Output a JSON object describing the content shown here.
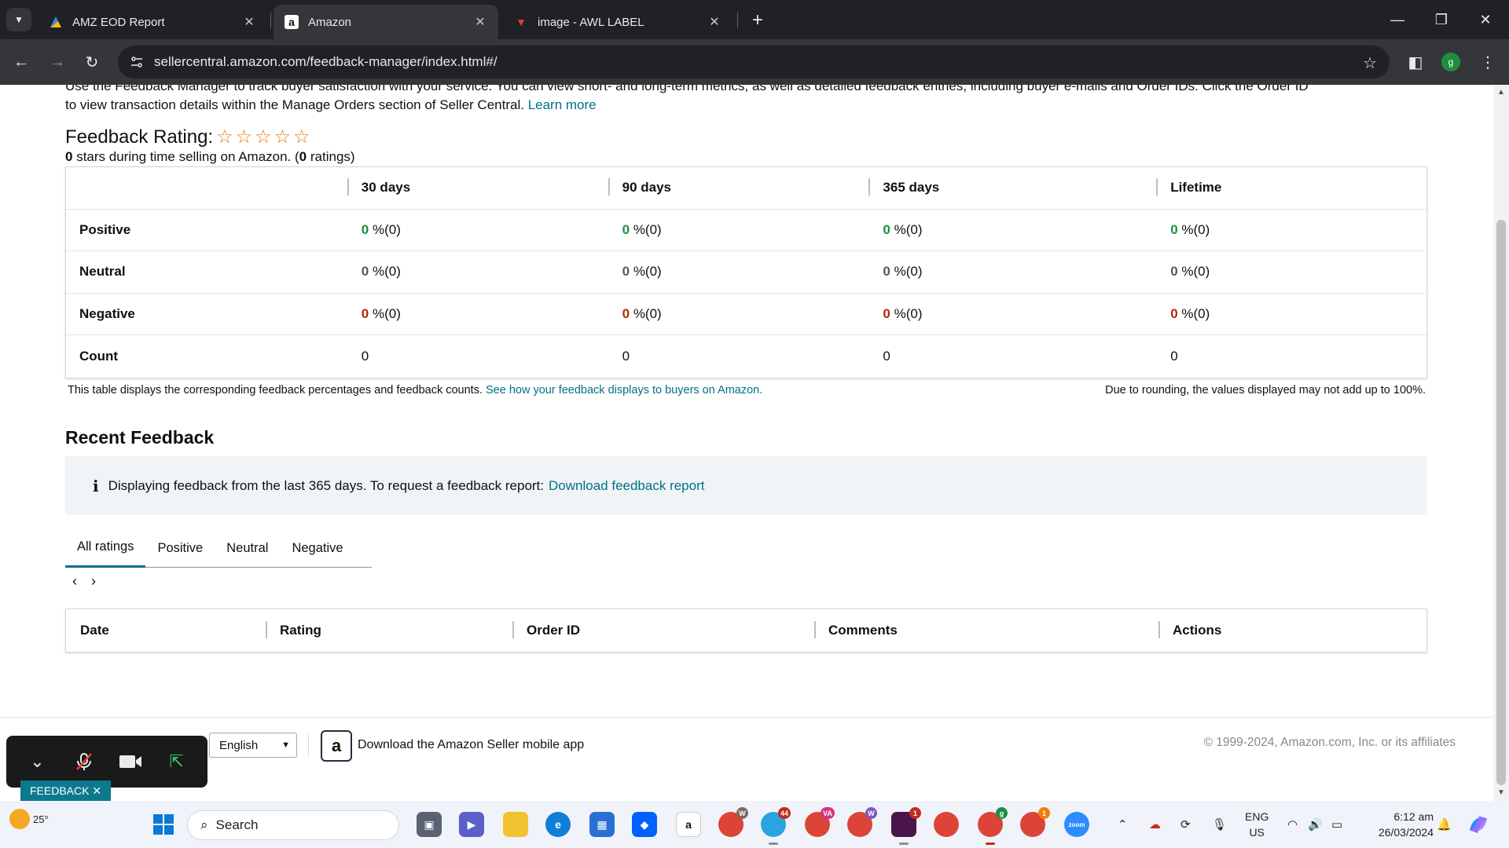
{
  "browser": {
    "tabs": [
      {
        "title": "AMZ EOD Report",
        "icon": "report-icon"
      },
      {
        "title": "Amazon",
        "icon": "amazon-icon"
      },
      {
        "title": "image - AWL LABEL",
        "icon": "awl-icon"
      }
    ],
    "url": "sellercentral.amazon.com/feedback-manager/index.html#/",
    "profile_initial": "g"
  },
  "intro": {
    "line1": "Use the Feedback Manager to track buyer satisfaction with your service. You can view short- and long-term metrics, as well as detailed feedback entries, including buyer e-mails and Order IDs. Click the Order ID",
    "line2": "to view transaction details within the Manage Orders section of Seller Central.",
    "learn_more": "Learn more"
  },
  "feedback": {
    "title": "Feedback Rating:",
    "star_count": 5,
    "stars_value": "0",
    "stars_text": "stars during time selling on Amazon. (",
    "ratings_value": "0",
    "ratings_text": "ratings)",
    "columns": [
      "30 days",
      "90 days",
      "365 days",
      "Lifetime"
    ],
    "rows": [
      {
        "label": "Positive",
        "values": [
          "0",
          "0",
          "0",
          "0"
        ],
        "suffix": "%(0)",
        "color": "#1e8e3e"
      },
      {
        "label": "Neutral",
        "values": [
          "0",
          "0",
          "0",
          "0"
        ],
        "suffix": "%(0)",
        "color": "#565959"
      },
      {
        "label": "Negative",
        "values": [
          "0",
          "0",
          "0",
          "0"
        ],
        "suffix": "%(0)",
        "color": "#b12704"
      },
      {
        "label": "Count",
        "values": [
          "0",
          "0",
          "0",
          "0"
        ],
        "suffix": ""
      }
    ],
    "note_left": "This table displays the corresponding feedback percentages and feedback counts.",
    "note_left_link": "See how your feedback displays to buyers on Amazon.",
    "note_right": "Due to rounding, the values displayed may not add up to 100%."
  },
  "recent": {
    "title": "Recent Feedback",
    "info_text": "Displaying feedback from the last 365 days. To request a feedback report:",
    "info_link": "Download feedback report",
    "tabs": [
      "All ratings",
      "Positive",
      "Neutral",
      "Negative"
    ],
    "active_tab": "All ratings",
    "columns": [
      "Date",
      "Rating",
      "Order ID",
      "Comments",
      "Actions"
    ]
  },
  "footer": {
    "language": "English",
    "app_text": "Download the Amazon Seller mobile app",
    "copyright": "© 1999-2024, Amazon.com, Inc. or its affiliates"
  },
  "widget": {
    "feedback_tab": "FEEDBACK"
  },
  "taskbar": {
    "temperature": "25°",
    "search_placeholder": "Search",
    "lang_line1": "ENG",
    "lang_line2": "US",
    "time": "6:12 am",
    "date": "26/03/2024",
    "badges": {
      "telegram": "44",
      "chrome_va": "VA",
      "slack": "1",
      "chrome_w1": "W",
      "chrome_w2": "W",
      "chrome_g": "g",
      "chrome_orange": "1"
    }
  }
}
